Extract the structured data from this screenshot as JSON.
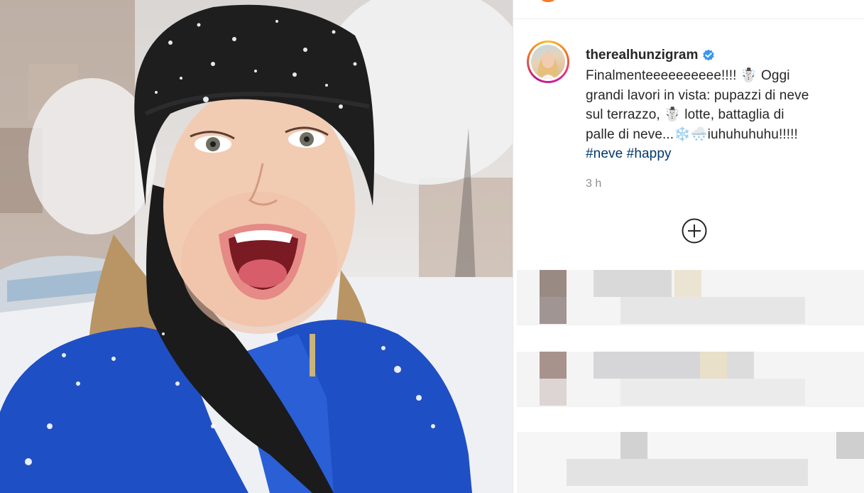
{
  "post": {
    "username": "therealhunzigram",
    "verified": true,
    "caption_lines": [
      "Finalmenteeeeeeeeee!!!! ☃️ Oggi",
      "grandi lavori in vista: pupazzi di neve",
      "sul terrazzo, ☃️ lotte, battaglia di",
      "palle di neve...❄️🌨️iuhuhuhuhu!!!!!"
    ],
    "hashtags": [
      "#neve",
      "#happy"
    ],
    "time_ago": "3 h"
  },
  "icons": {
    "verified": "verified-badge-icon",
    "add": "plus-circle-icon"
  },
  "colors": {
    "hashtag": "#00376b",
    "verified": "#3897f0",
    "jacket": "#1f4fc4",
    "beanie": "#1e1e1f"
  }
}
